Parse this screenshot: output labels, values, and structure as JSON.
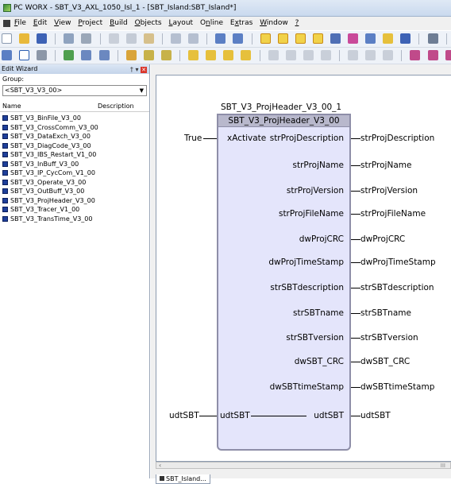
{
  "window": {
    "title": "PC WORX - SBT_V3_AXL_1050_Isl_1 - [SBT_Island:SBT_Island*]"
  },
  "menu": [
    {
      "pre": "",
      "key": "F",
      "post": "ile"
    },
    {
      "pre": "",
      "key": "E",
      "post": "dit"
    },
    {
      "pre": "",
      "key": "V",
      "post": "iew"
    },
    {
      "pre": "",
      "key": "P",
      "post": "roject"
    },
    {
      "pre": "",
      "key": "B",
      "post": "uild"
    },
    {
      "pre": "",
      "key": "O",
      "post": "bjects"
    },
    {
      "pre": "",
      "key": "L",
      "post": "ayout"
    },
    {
      "pre": "O",
      "key": "n",
      "post": "line"
    },
    {
      "pre": "E",
      "key": "x",
      "post": "tras"
    },
    {
      "pre": "",
      "key": "W",
      "post": "indow"
    },
    {
      "pre": "",
      "key": "?",
      "post": ""
    }
  ],
  "edit_wizard": {
    "title": "Edit Wizard",
    "group_label": "Group:",
    "group_value": "<SBT_V3_V3_00>",
    "col_name": "Name",
    "col_description": "Description",
    "items": [
      "SBT_V3_BinFile_V3_00",
      "SBT_V3_CrossComm_V3_00",
      "SBT_V3_DataExch_V3_00",
      "SBT_V3_DiagCode_V3_00",
      "SBT_V3_IBS_Restart_V1_00",
      "SBT_V3_InBuff_V3_00",
      "SBT_V3_IP_CycCom_V1_00",
      "SBT_V3_Operate_V3_00",
      "SBT_V3_OutBuff_V3_00",
      "SBT_V3_ProjHeader_V3_00",
      "SBT_V3_Tracer_V1_00",
      "SBT_V3_TransTime_V3_00"
    ]
  },
  "fb": {
    "instance": "SBT_V3_ProjHeader_V3_00_1",
    "type": "SBT_V3_ProjHeader_V3_00",
    "inputs": {
      "xActivate": {
        "pin": "xActivate",
        "var": "True"
      }
    },
    "outputs": [
      {
        "pin": "strProjDescription",
        "var": "strProjDescription"
      },
      {
        "pin": "strProjName",
        "var": "strProjName"
      },
      {
        "pin": "strProjVersion",
        "var": "strProjVersion"
      },
      {
        "pin": "strProjFileName",
        "var": "strProjFileName"
      },
      {
        "pin": "dwProjCRC",
        "var": "dwProjCRC"
      },
      {
        "pin": "dwProjTimeStamp",
        "var": "dwProjTimeStamp"
      },
      {
        "pin": "strSBTdescription",
        "var": "strSBTdescription"
      },
      {
        "pin": "strSBTname",
        "var": "strSBTname"
      },
      {
        "pin": "strSBTversion",
        "var": "strSBTversion"
      },
      {
        "pin": "dwSBT_CRC",
        "var": "dwSBT_CRC"
      },
      {
        "pin": "dwSBTtimeStamp",
        "var": "dwSBTtimeStamp"
      }
    ],
    "inout": {
      "pin_in": "udtSBT",
      "pin_out": "udtSBT",
      "var_in": "udtSBT",
      "var_out": "udtSBT"
    }
  },
  "scrollbar": {
    "grip": "III"
  },
  "tabs": [
    {
      "label": "SBT_Island..."
    }
  ],
  "colors": {
    "block_fill": "#e4e5fb",
    "block_header": "#b8b8cc",
    "block_border": "#8e8ea8"
  }
}
